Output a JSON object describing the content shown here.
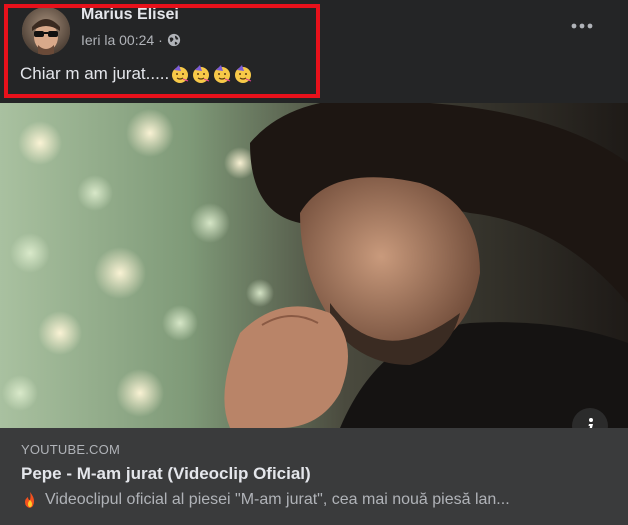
{
  "post": {
    "author_name": "Marius Elisei",
    "timestamp": "Ieri la 00:24",
    "separator": "·",
    "audience_icon": "globe-icon",
    "more_icon": "more-options-icon",
    "text": "Chiar m am jurat.....",
    "emojis": [
      "partying-face-icon",
      "partying-face-icon",
      "partying-face-icon",
      "partying-face-icon"
    ]
  },
  "link_preview": {
    "domain": "YOUTUBE.COM",
    "title": "Pepe - M-am jurat (Videoclip Oficial)",
    "description_icon": "fire-icon",
    "description": "Videoclipul oficial al piesei \"M-am jurat\", cea mai nouă piesă lan..."
  },
  "media": {
    "info_icon": "info-icon"
  },
  "colors": {
    "background": "#242526",
    "preview_background": "#3a3b3c",
    "primary_text": "#e4e6eb",
    "secondary_text": "#b0b3b8",
    "highlight_border": "#e8111b"
  }
}
